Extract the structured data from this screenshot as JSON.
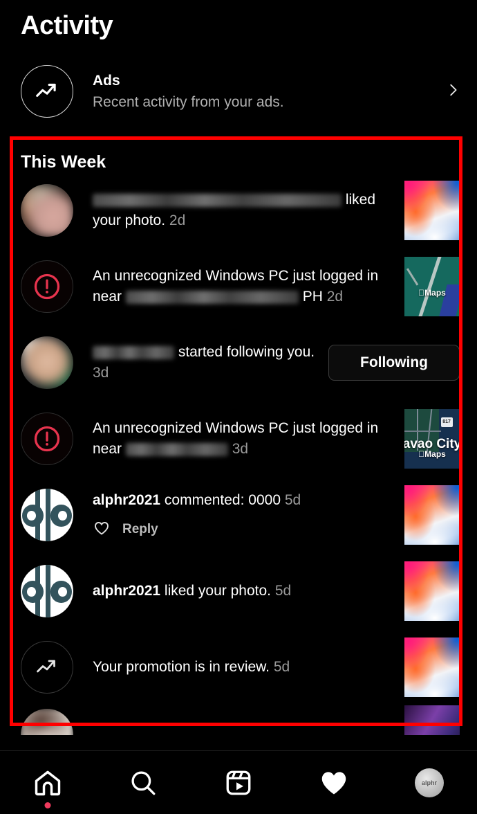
{
  "header": {
    "title": "Activity"
  },
  "ads": {
    "icon": "trending-up-icon",
    "title": "Ads",
    "subtitle": "Recent activity from your ads.",
    "chevron": "›"
  },
  "section": {
    "title": "This Week"
  },
  "notifications": [
    {
      "id": "liked-photo-blurred",
      "avatar_type": "blurred-person",
      "username": "",
      "username_blurred": true,
      "text": " liked your photo.",
      "time": "2d",
      "thumb_type": "wallpaper"
    },
    {
      "id": "login-alert-1",
      "avatar_type": "alert",
      "text_before": "An unrecognized Windows PC just logged in near ",
      "location_blurred": true,
      "text_after": " PH",
      "time": "2d",
      "thumb_type": "map-green",
      "maps_brand": "Maps"
    },
    {
      "id": "started-following",
      "avatar_type": "blurred-person",
      "username": "",
      "username_blurred": true,
      "text": " started following you.",
      "time": "3d",
      "action_label": "Following"
    },
    {
      "id": "login-alert-2",
      "avatar_type": "alert",
      "text_before": "An unrecognized Windows PC just logged in near ",
      "location_blurred": true,
      "text_after": "",
      "time": "3d",
      "thumb_type": "map-dark",
      "map_label": "avao City",
      "maps_brand": "Maps",
      "shield_label": "817"
    },
    {
      "id": "commented",
      "avatar_type": "alphr-logo",
      "username": "alphr2021",
      "text": " commented: 0000",
      "time": "5d",
      "reply_label": "Reply",
      "heart_icon": "heart-outline-icon",
      "thumb_type": "wallpaper"
    },
    {
      "id": "liked-photo-alphr",
      "avatar_type": "alphr-logo",
      "username": "alphr2021",
      "text": " liked your photo.",
      "time": "5d",
      "thumb_type": "wallpaper"
    },
    {
      "id": "promotion-review",
      "avatar_type": "promo",
      "username": "",
      "text": "Your promotion is in review.",
      "time": "5d",
      "thumb_type": "wallpaper"
    }
  ],
  "nav": {
    "items": [
      {
        "icon": "home-icon",
        "label": "Home",
        "active": true,
        "badge": true
      },
      {
        "icon": "search-icon",
        "label": "Search",
        "active": false,
        "badge": false
      },
      {
        "icon": "reels-icon",
        "label": "Reels",
        "active": false,
        "badge": false
      },
      {
        "icon": "heart-filled-icon",
        "label": "Activity",
        "active": true,
        "badge": false
      },
      {
        "icon": "profile-avatar",
        "label": "Profile",
        "active": false,
        "badge": false
      }
    ]
  },
  "colors": {
    "background": "#000000",
    "text_primary": "#ffffff",
    "text_secondary": "#9a9a9a",
    "alert_red": "#e8344e",
    "highlight_border": "#ff0000",
    "badge_dot": "#ef3a5d"
  }
}
